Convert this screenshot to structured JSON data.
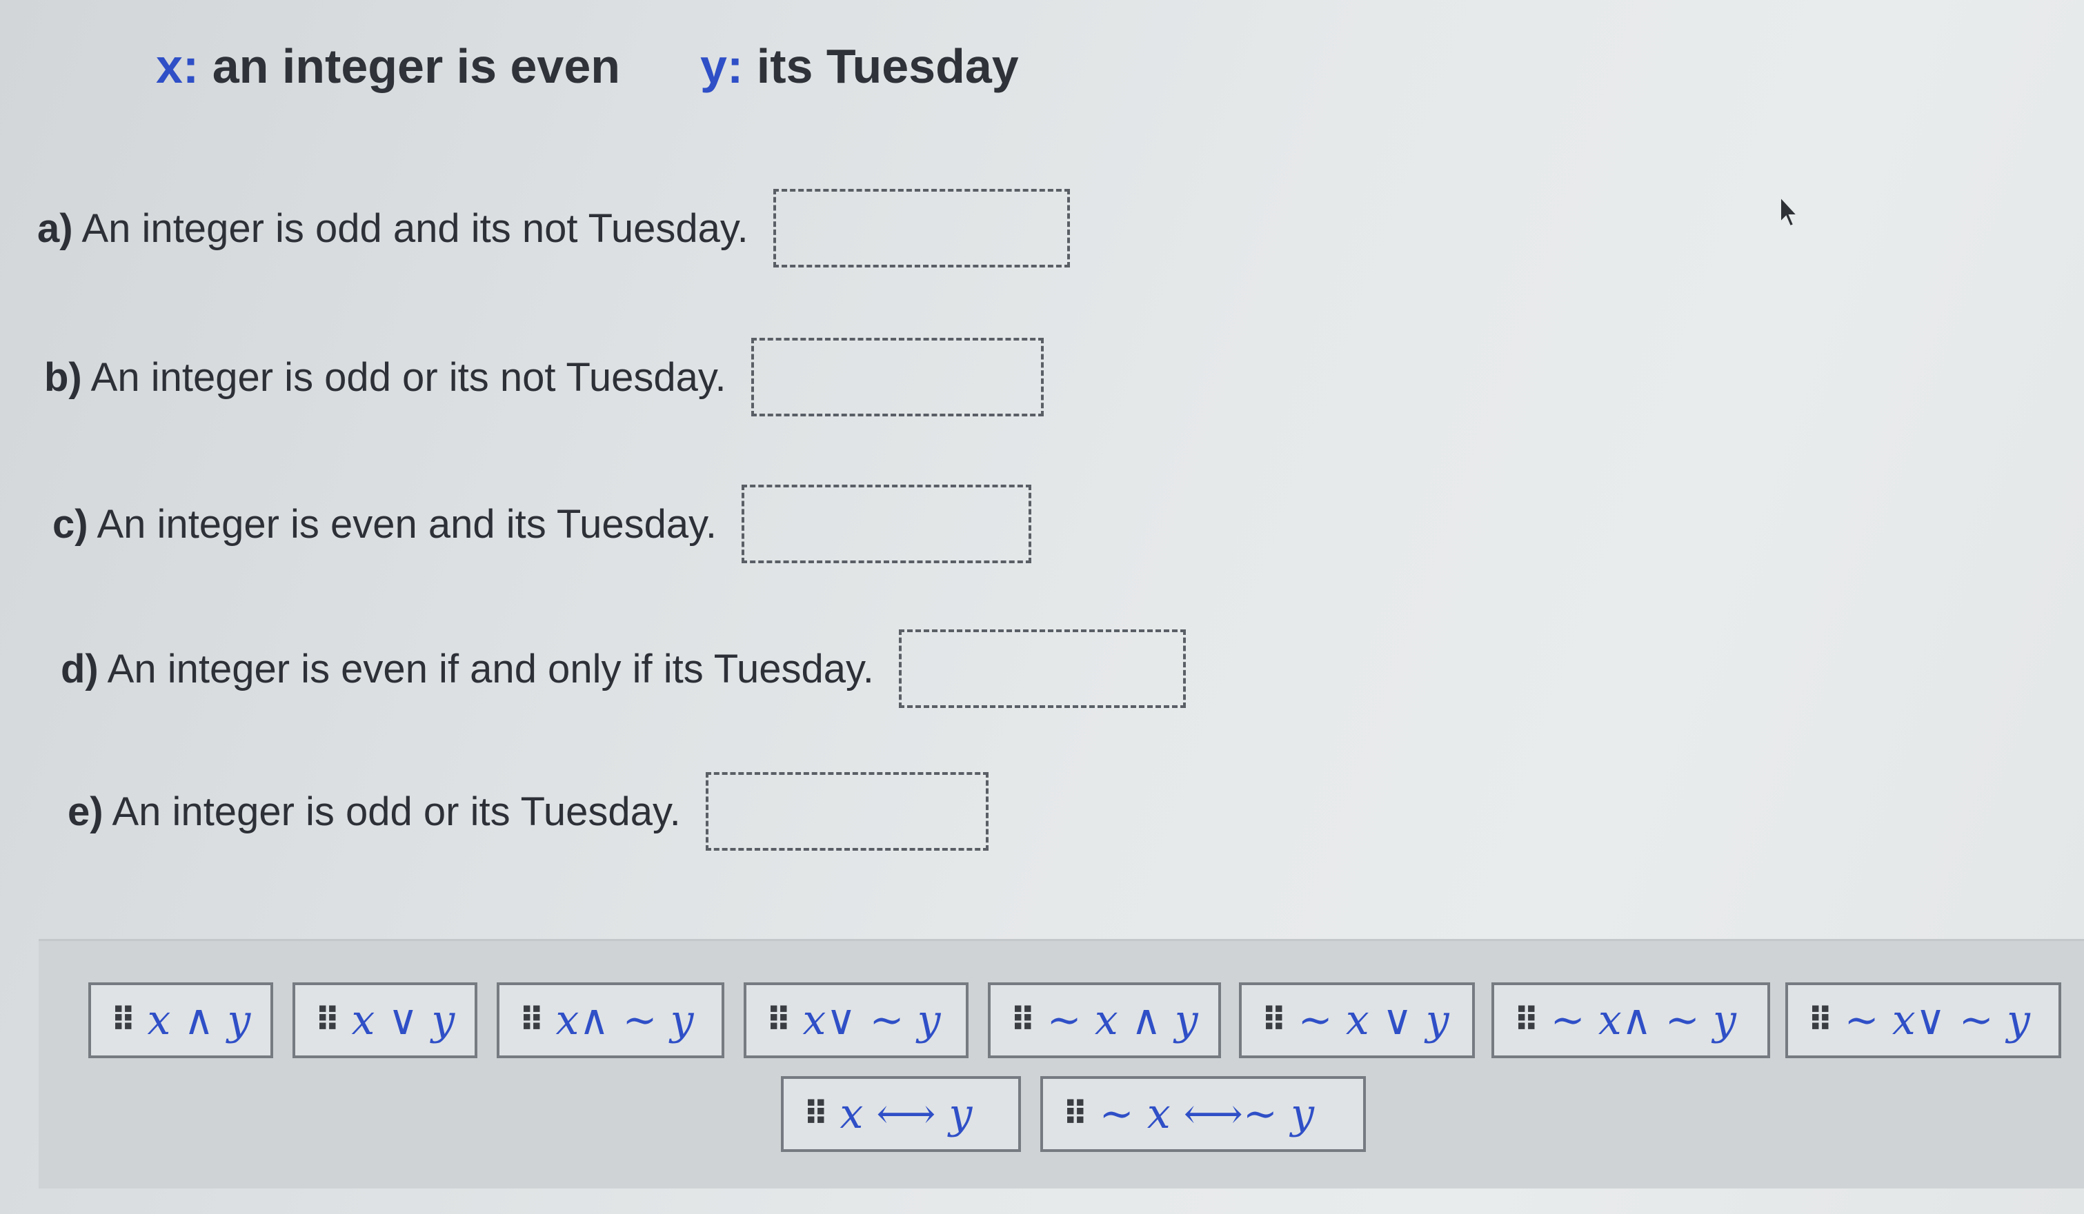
{
  "header": {
    "x_var": "x:",
    "x_def": " an integer is even",
    "y_var": "y:",
    "y_def": " its Tuesday"
  },
  "questions": [
    {
      "letter": "a)",
      "text": " An integer is odd and its not Tuesday."
    },
    {
      "letter": "b)",
      "text": " An integer is odd or its not Tuesday."
    },
    {
      "letter": "c)",
      "text": " An integer is even and its Tuesday."
    },
    {
      "letter": "d)",
      "text": " An integer is even if and only if its Tuesday."
    },
    {
      "letter": "e)",
      "text": " An integer is odd or its Tuesday."
    }
  ],
  "palette": {
    "grip_icon": "drag-grip-icon",
    "tiles": [
      {
        "expr": "x ∧ y"
      },
      {
        "expr": "x ∨ y"
      },
      {
        "expr": "x∧ ∼ y"
      },
      {
        "expr": "x∨ ∼ y"
      },
      {
        "expr": "∼ x ∧ y"
      },
      {
        "expr": "∼ x ∨ y"
      },
      {
        "expr": "∼ x∧ ∼ y"
      },
      {
        "expr": "∼ x∨ ∼ y"
      },
      {
        "expr": "x ⟷ y"
      },
      {
        "expr": "∼ x ⟷∼ y"
      }
    ]
  },
  "colors": {
    "variable": "#2f4fc7",
    "text": "#2d3037",
    "dropzone_border": "#5a5f66",
    "tile_border": "#767b82"
  }
}
